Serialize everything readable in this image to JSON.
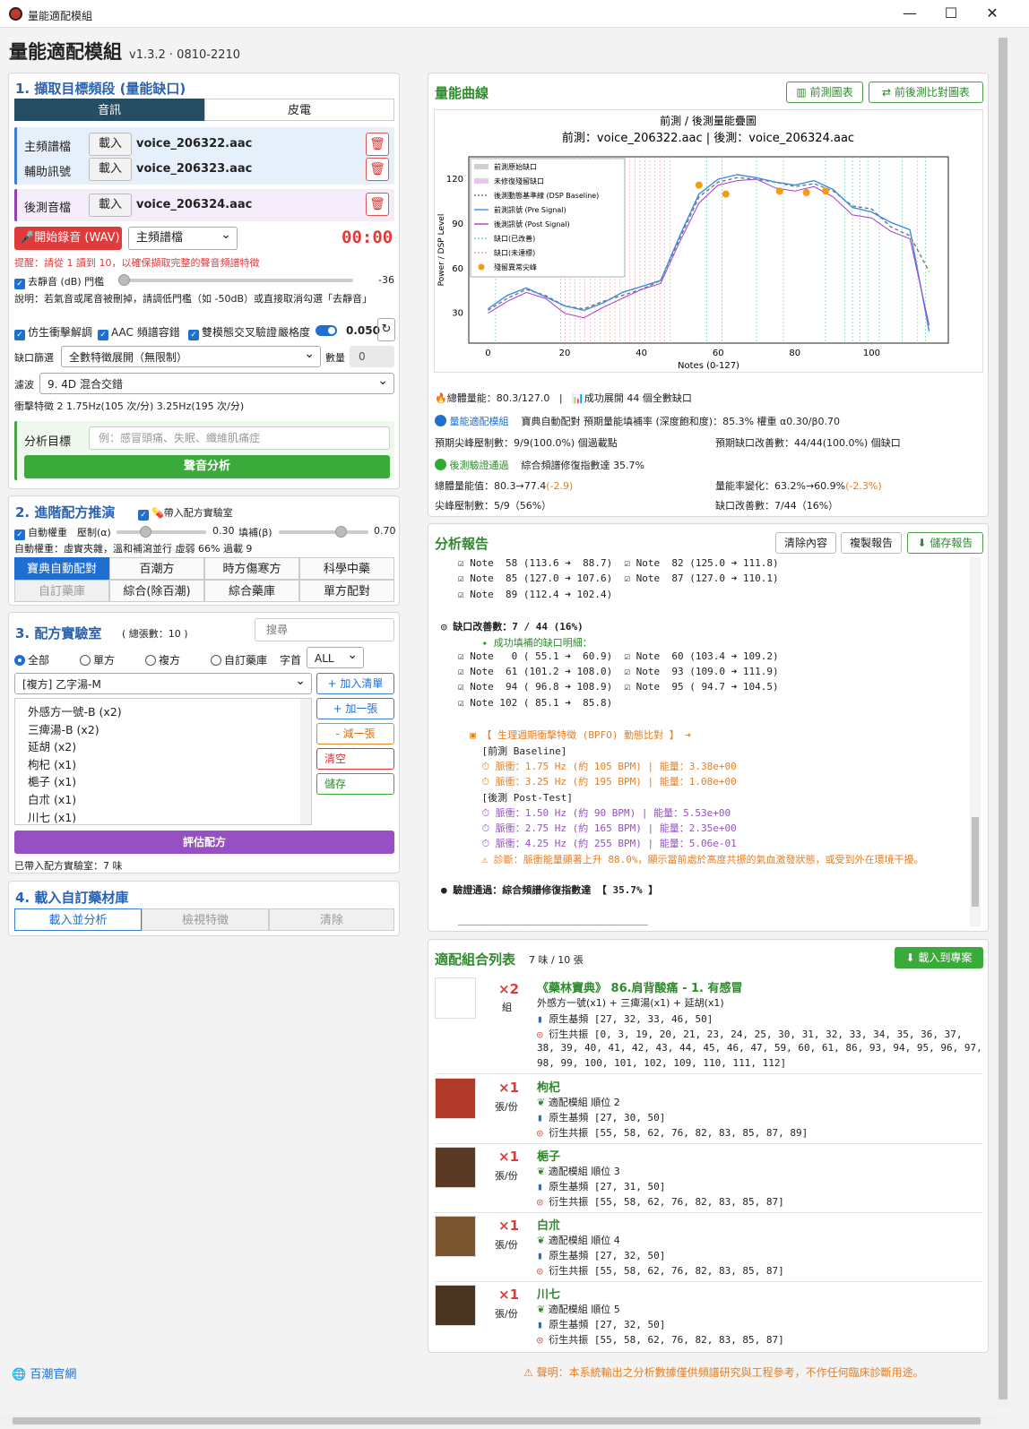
{
  "window": {
    "title": "量能適配模組",
    "minimize": "—",
    "maximize": "☐",
    "close": "✕"
  },
  "app": {
    "name": "量能適配模組",
    "version": "v1.3.2 · 0810-2210"
  },
  "capture": {
    "heading": "1. 擷取目標頻段 (量能缺口)",
    "tabs": [
      "音訊",
      "皮電"
    ],
    "main_label": "主頻譜檔",
    "aux_label": "輔助訊號",
    "post_label": "後測音檔",
    "load_label": "載入",
    "main_file": "voice_206322.aac",
    "aux_file": "voice_206323.aac",
    "post_file": "voice_206324.aac",
    "record_label": "開始錄音 (WAV)",
    "record_target": "主頻譜檔",
    "timer": "00:00",
    "hint": "提醒：請從 1 讀到 10，以確保擷取完整的聲音頻譜特徵",
    "denoise_label": "去靜音 (dB) 門檻",
    "denoise_value": "-36",
    "denoise_note": "說明：若氣音或尾音被刪掉，請調低門檻（如 -50dB）或直接取消勾選「去靜音」",
    "opt1": "仿生衝擊解調",
    "opt2": "AAC 頻譜容錯",
    "opt3": "雙模態交叉驗證",
    "strict_label": "嚴格度",
    "strict_value": "0.050",
    "gap_label": "缺口篩選",
    "gap_select": "全數特徵展開（無限制）",
    "count_label": "數量",
    "count_value": "0",
    "filter_label": "濾波",
    "filter_select": "9. 4D 混合交錯",
    "impact": "衝擊特徵 2   1.75Hz(105 次/分)   3.25Hz(195 次/分)",
    "target_label": "分析目標",
    "target_placeholder": "例：感冒頭痛、失眠、纖維肌痛症",
    "analyze_label": "聲音分析"
  },
  "formula": {
    "heading": "2. 進階配方推演",
    "lab_check": "帶入配方實驗室",
    "auto_weight": "自動權重",
    "alpha_label": "壓制(α)",
    "alpha_value": "0.30",
    "beta_label": "填補(β)",
    "beta_value": "0.70",
    "weight_note": "自動權重：虛實夾雜，溫和補瀉並行   虛弱 66%   過載 9",
    "modes": [
      "寶典自動配對",
      "百潮方",
      "時方傷寒方",
      "科學中藥",
      "自訂藥庫",
      "綜合(除百潮)",
      "綜合藥庫",
      "單方配對"
    ]
  },
  "lab": {
    "heading": "3. 配方實驗室",
    "count_note": "( 總張數：10 )",
    "search_placeholder": "搜尋",
    "radios": [
      "全部",
      "單方",
      "複方",
      "自訂藥庫"
    ],
    "initial_label": "字首",
    "initial_value": "ALL",
    "formula_select": "[複方] 乙字湯-M",
    "items": [
      "外感方一號-B (x2)",
      "三痺湯-B (x2)",
      "延胡 (x2)",
      "枸杞 (x1)",
      "梔子 (x1)",
      "白朮 (x1)",
      "川七 (x1)"
    ],
    "btn_add_list": "+ 加入清單",
    "btn_add_one": "+ 加一張",
    "btn_remove_one": "- 減一張",
    "btn_clear": "清空",
    "btn_save": "儲存",
    "evaluate": "評估配方",
    "footer": "已帶入配方實驗室：7 味"
  },
  "library": {
    "heading": "4. 載入自訂藥材庫",
    "tabs": [
      "載入並分析",
      "檢視特徵",
      "清除"
    ]
  },
  "energy": {
    "heading": "量能曲線",
    "btn_pre": "前測圖表",
    "btn_compare": "前後測比對圖表",
    "stat_total": "總體量能：80.3/127.0",
    "stat_sep": "|",
    "stat_gap": "成功展開 44 個全數缺口",
    "match_tag": "量能適配模組",
    "match_line": "寶典自動配對    預期量能填補率 (深度飽和度)：85.3%    權重 α0.30/β0.70",
    "pred_peak": "預期尖峰壓制數：9/9(100.0%) 個過載點",
    "pred_gap": "預期缺口改善數：44/44(100.0%) 個缺口",
    "verify_tag": "後測驗證通過",
    "verify_line": "綜合頻譜修復指數達 35.7%",
    "post_total": "總體量能值：80.3→77.4",
    "post_total_delta": "(-2.9)",
    "post_rate": "量能率變化：63.2%→60.9%",
    "post_rate_delta": "(-2.3%)",
    "post_peak": "尖峰壓制數：5/9（56%）",
    "post_gap": "缺口改善數：7/44（16%）"
  },
  "chart_data": {
    "type": "line",
    "title": "前測 / 後測量能疊圖",
    "subtitle": "前測：voice_206322.aac   |   後測：voice_206324.aac",
    "xlabel": "Notes (0-127)",
    "ylabel": "Power / DSP Level",
    "xlim": [
      -5,
      120
    ],
    "ylim": [
      10,
      135
    ],
    "xticks": [
      0,
      20,
      40,
      60,
      80,
      100
    ],
    "yticks": [
      30,
      60,
      90,
      120
    ],
    "legend": [
      "前測原始缺口",
      "未修復殘留缺口",
      "後測動態基準線 (DSP Baseline)",
      "前測訊號 (Pre Signal)",
      "後測訊號 (Post Signal)",
      "缺口(已改善)",
      "缺口(未達標)",
      "殘留異常尖峰"
    ],
    "legend_position": "top-left",
    "series": [
      {
        "name": "後測動態基準線 (DSP Baseline)",
        "color": "#777777",
        "x": [
          0,
          5,
          10,
          15,
          20,
          25,
          30,
          35,
          40,
          45,
          50,
          55,
          60,
          65,
          70,
          75,
          80,
          85,
          90,
          95,
          100,
          105,
          110,
          115
        ],
        "values": [
          32,
          40,
          46,
          42,
          35,
          33,
          38,
          42,
          46,
          52,
          80,
          108,
          118,
          121,
          120,
          118,
          115,
          117,
          112,
          102,
          100,
          88,
          82,
          58
        ]
      },
      {
        "name": "前測訊號 (Pre Signal)",
        "color": "#3a8ee6",
        "x": [
          0,
          5,
          10,
          15,
          20,
          25,
          30,
          35,
          40,
          45,
          50,
          55,
          60,
          65,
          70,
          75,
          80,
          85,
          90,
          95,
          100,
          105,
          110,
          115
        ],
        "values": [
          33,
          42,
          47,
          41,
          35,
          32,
          37,
          44,
          48,
          52,
          82,
          110,
          120,
          123,
          121,
          118,
          116,
          119,
          113,
          101,
          98,
          91,
          86,
          18
        ]
      },
      {
        "name": "後測訊號 (Post Signal)",
        "color": "#a83cc9",
        "x": [
          0,
          5,
          10,
          15,
          20,
          25,
          30,
          35,
          40,
          45,
          50,
          55,
          60,
          65,
          70,
          75,
          80,
          85,
          90,
          95,
          100,
          105,
          110,
          115
        ],
        "values": [
          30,
          38,
          44,
          40,
          30,
          27,
          34,
          40,
          46,
          50,
          78,
          104,
          116,
          119,
          120,
          114,
          112,
          115,
          108,
          96,
          94,
          85,
          80,
          22
        ]
      }
    ],
    "spikes": {
      "name": "殘留異常尖峰",
      "x": [
        55,
        62,
        76,
        83,
        88
      ],
      "values": [
        116,
        110,
        112,
        111,
        112
      ]
    }
  },
  "report": {
    "heading": "分析報告",
    "btn_clear": "清除內容",
    "btn_copy": "複製報告",
    "btn_save": "儲存報告",
    "lines": [
      "☑ Note  58 (113.6 ➜  88.7)  ☑ Note  82 (125.0 ➜ 111.8)",
      "☑ Note  85 (127.0 ➜ 107.6)  ☑ Note  87 (127.0 ➜ 110.1)",
      "☑ Note  89 (112.4 ➜ 102.4)",
      "",
      "◎ 缺口改善數：7 / 44 (16%)",
      "    ✦ 成功填補的缺口明細：",
      "☑ Note   0 ( 55.1 ➜  60.9)  ☑ Note  60 (103.4 ➜ 109.2)",
      "☑ Note  61 (101.2 ➜ 108.0)  ☑ Note  93 (109.0 ➜ 111.9)",
      "☑ Note  94 ( 96.8 ➜ 108.9)  ☑ Note  95 ( 94.7 ➜ 104.5)",
      "☑ Note 102 ( 85.1 ➜  85.8)",
      "",
      "  ▣ 【 生理週期衝擊特徵 (BPFO) 動態比對 】 ➜",
      "    [前測 Baseline]",
      "    ⏱ 脈衝：1.75 Hz (約 105 BPM) | 能量：3.38e+00",
      "    ⏱ 脈衝：3.25 Hz (約 195 BPM) | 能量：1.08e+00",
      "    [後測 Post-Test]",
      "    ⏱ 脈衝：1.50 Hz (約 90 BPM) | 能量：5.53e+00",
      "    ⏱ 脈衝：2.75 Hz (約 165 BPM) | 能量：2.35e+00",
      "    ⏱ 脈衝：4.25 Hz (約 255 BPM) | 能量：5.06e-01",
      "    ⚠ 診斷：脈衝能量顯著上升 88.0%，顯示當前處於高度共振的氣血激發狀態，或受到外在環境干擾。",
      "",
      "● 驗證通過：綜合頻譜修復指數達 【 35.7% 】",
      "",
      "________________________________"
    ]
  },
  "matches": {
    "heading": "適配組合列表",
    "count": "7 味 / 10 張",
    "btn_load": "載入到專案",
    "first": {
      "mult": "×2",
      "unit": "組",
      "title": "《藥林寶典》 86.肩背酸痛 - 1. 有感冒",
      "formula": "外感方一號(x1) + 三痺湯(x1) + 延胡(x1)",
      "base": "原生基頻 [27, 32, 33, 46, 50]",
      "derived": "衍生共振 [0, 3, 19, 20, 21, 23, 24, 25, 30, 31, 32, 33, 34, 35, 36, 37,",
      "derived2": "38, 39, 40, 41, 42, 43, 44, 45, 46, 47, 59, 60, 61, 86, 93, 94, 95, 96, 97,",
      "derived3": "98, 99, 100, 101, 102, 109, 110, 111, 112]"
    },
    "items": [
      {
        "mult": "×1",
        "unit": "張/份",
        "name": "枸杞",
        "rank": "適配模組 順位 2",
        "base": "原生基頻 [27, 30, 50]",
        "derived": "衍生共振 [55, 58, 62, 76, 82, 83, 85, 87, 89]",
        "color": "#b23a2a"
      },
      {
        "mult": "×1",
        "unit": "張/份",
        "name": "梔子",
        "rank": "適配模組 順位 3",
        "base": "原生基頻 [27, 31, 50]",
        "derived": "衍生共振 [55, 58, 62, 76, 82, 83, 85, 87]",
        "color": "#5a3a22"
      },
      {
        "mult": "×1",
        "unit": "張/份",
        "name": "白朮",
        "rank": "適配模組 順位 4",
        "base": "原生基頻 [27, 32, 50]",
        "derived": "衍生共振 [55, 58, 62, 76, 82, 83, 85, 87]",
        "color": "#7a5530"
      },
      {
        "mult": "×1",
        "unit": "張/份",
        "name": "川七",
        "rank": "適配模組 順位 5",
        "base": "原生基頻 [27, 32, 50]",
        "derived": "衍生共振 [55, 58, 62, 76, 82, 83, 85, 87]",
        "color": "#4a3522"
      }
    ]
  },
  "footer": {
    "site": "百潮官網",
    "disclaimer": "聲明：本系統輸出之分析數據僅供頻譜研究與工程參考，不作任何臨床診斷用途。"
  }
}
